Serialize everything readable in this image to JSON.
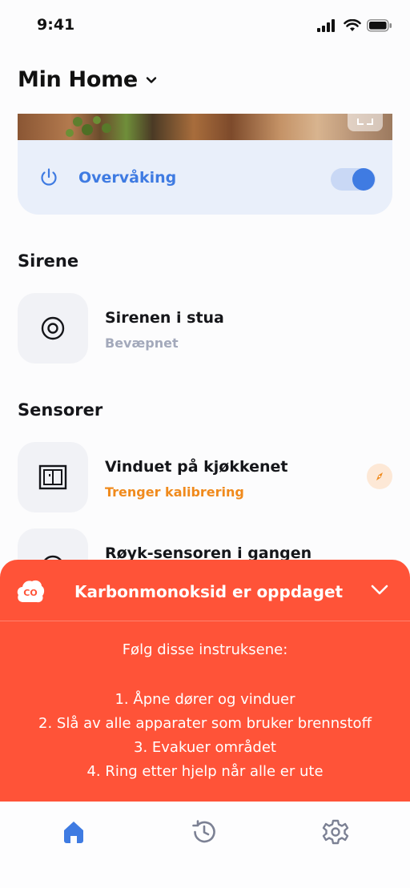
{
  "status_bar": {
    "time": "9:41"
  },
  "header": {
    "title": "Min Home"
  },
  "monitoring": {
    "label": "Overvåking",
    "enabled": true
  },
  "sections": {
    "siren_title": "Sirene",
    "sensors_title": "Sensorer"
  },
  "siren": {
    "name": "Sirenen i stua",
    "status": "Bevæpnet"
  },
  "sensors": [
    {
      "name": "Vinduet på kjøkkenet",
      "status": "Trenger kalibrering"
    },
    {
      "name": "Røyk-sensoren i gangen"
    }
  ],
  "alert": {
    "badge": "CO",
    "title": "Karbonmonoksid er oppdaget",
    "intro": "Følg disse instruksene:",
    "steps": [
      "1. Åpne dører og vinduer",
      "2. Slå av alle apparater som bruker brennstoff",
      "3. Evakuer området",
      "4. Ring etter hjelp når alle er ute"
    ]
  },
  "tabs": [
    {
      "icon": "home-icon",
      "active": true
    },
    {
      "icon": "history-icon",
      "active": false
    },
    {
      "icon": "settings-icon",
      "active": false
    }
  ],
  "colors": {
    "accent": "#3f7be2",
    "alert": "#ff5338",
    "warning": "#f08a1c",
    "muted": "#a3a9bb"
  }
}
